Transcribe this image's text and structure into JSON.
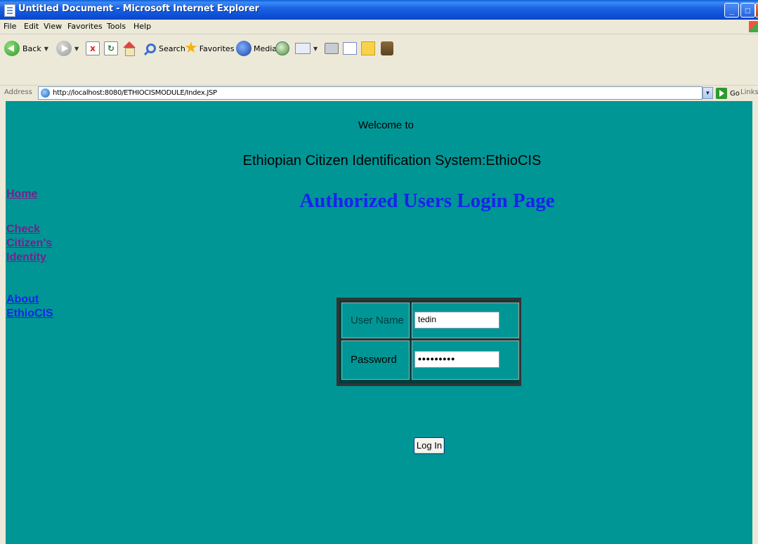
{
  "window": {
    "title": "Untitled Document - Microsoft Internet Explorer",
    "minimize_glyph": "_",
    "maximize_glyph": "□",
    "close_glyph": "X"
  },
  "menu": [
    "File",
    "Edit",
    "View",
    "Favorites",
    "Tools",
    "Help"
  ],
  "toolbar": {
    "back_label": "Back",
    "search_label": "Search",
    "favorites_label": "Favorites",
    "media_label": "Media",
    "stop_glyph": "x",
    "refresh_glyph": "↻"
  },
  "address_bar": {
    "label": "Address",
    "url": "http://localhost:8080/ETHIOCISMODULE/Index.JSP",
    "go_label": "Go",
    "links_label": "Links"
  },
  "page": {
    "welcome": "Welcome to",
    "system_name": "Ethiopian Citizen Identification System:EthioCIS",
    "heading": "Authorized Users Login Page",
    "nav": {
      "home": "Home",
      "check_line1": "Check",
      "check_line2": "Citizen's",
      "check_line3": "Identity",
      "about_line1": "About",
      "about_line2": "EthioCIS"
    },
    "form": {
      "username_label": "User Name",
      "username_value": "tedin",
      "password_label": "Password",
      "password_value": "•••••••••",
      "login_button": "Log In"
    }
  },
  "colors": {
    "page_background": "#009696",
    "heading": "#1a22ee",
    "visited_link": "#7a1f8a",
    "link": "#1a22ee"
  }
}
